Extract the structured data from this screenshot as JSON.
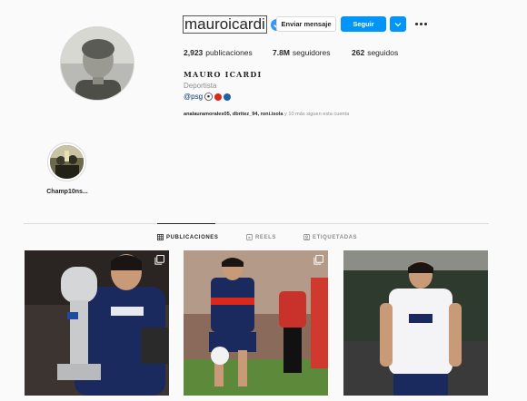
{
  "profile": {
    "username": "mauroicardi",
    "message_button": "Enviar mensaje",
    "follow_button": "Seguir",
    "stats": {
      "posts_count": "2,923",
      "posts_label": "publicaciones",
      "followers_count": "7.8M",
      "followers_label": "seguidores",
      "following_count": "262",
      "following_label": "seguidos"
    },
    "full_name": "MAURO ICARDI",
    "category": "Deportista",
    "bio_link": "@psg",
    "followed_by": {
      "names": "analauramorales05, dbritez_94, roni.isola",
      "suffix": " y 10 más siguen esta cuenta"
    }
  },
  "highlights": [
    {
      "label": "Champ10ns..."
    }
  ],
  "tabs": [
    {
      "label": "PUBLICACIONES",
      "active": true
    },
    {
      "label": "REELS",
      "active": false
    },
    {
      "label": "ETIQUETADAS",
      "active": false
    }
  ],
  "colors": {
    "accent": "#0095f6",
    "psg_navy": "#1b2a5e",
    "psg_red": "#da291c",
    "verified": "#3897f0"
  }
}
